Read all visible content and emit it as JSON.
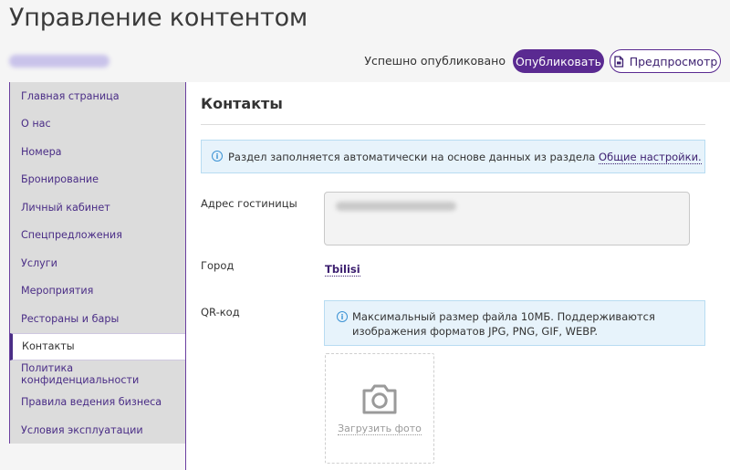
{
  "header": {
    "title": "Управление контентом",
    "status": "Успешно опубликовано",
    "publish_label": "Опубликовать",
    "preview_label": "Предпросмотр"
  },
  "sidebar": {
    "items": [
      {
        "label": "Главная страница"
      },
      {
        "label": "О нас"
      },
      {
        "label": "Номера"
      },
      {
        "label": "Бронирование"
      },
      {
        "label": "Личный кабинет"
      },
      {
        "label": "Спецпредложения"
      },
      {
        "label": "Услуги"
      },
      {
        "label": "Мероприятия"
      },
      {
        "label": "Рестораны и бары"
      },
      {
        "label": "Контакты",
        "active": true
      },
      {
        "label": "Политика конфиденциальности"
      },
      {
        "label": "Правила ведения бизнеса"
      },
      {
        "label": "Условия эксплуатации"
      }
    ]
  },
  "main": {
    "section_title": "Контакты",
    "info_text": "Раздел заполняется автоматически на основе данных из раздела",
    "info_link": "Общие настройки.",
    "address_label": "Адрес гостиницы",
    "city_label": "Город",
    "city_value": "Tbilisi",
    "qr_label": "QR-код",
    "qr_info": "Максимальный размер файла 10МБ. Поддерживаются изображения форматов JPG, PNG, GIF, WEBP.",
    "upload_label": "Загрузить фото"
  },
  "colors": {
    "accent": "#5a2a91",
    "link": "#3d2070",
    "info_bg": "#e7f3fb",
    "info_border": "#b8dcf2",
    "sidebar_bg": "#dcdcdc"
  },
  "icons": [
    "info-icon",
    "document-icon",
    "camera-icon"
  ]
}
